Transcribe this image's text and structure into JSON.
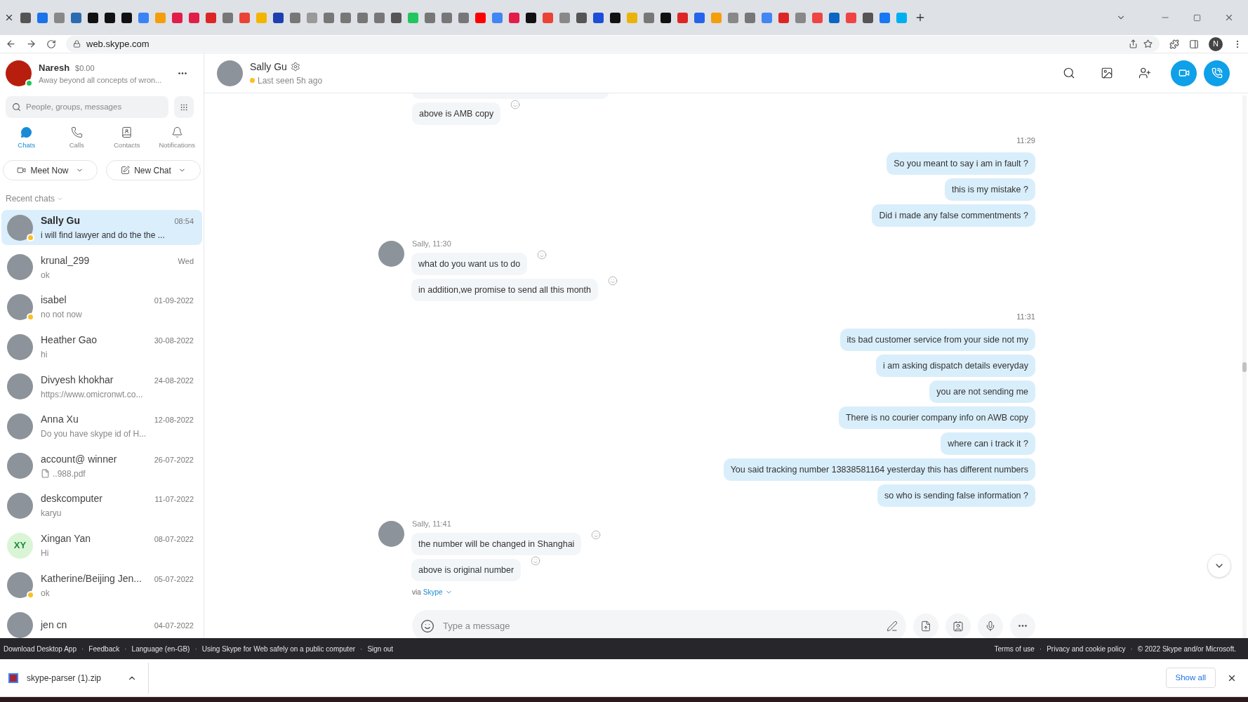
{
  "browser": {
    "url": "web.skype.com",
    "profile_initial": "N"
  },
  "profile": {
    "name": "Naresh",
    "balance": "$0.00",
    "mood": "Away beyond all concepts of wron...",
    "online": true
  },
  "search": {
    "placeholder": "People, groups, messages"
  },
  "nav_tabs": [
    {
      "label": "Chats",
      "selected": true
    },
    {
      "label": "Calls",
      "selected": false
    },
    {
      "label": "Contacts",
      "selected": false
    },
    {
      "label": "Notifications",
      "selected": false
    }
  ],
  "actions": [
    {
      "label": "Meet Now"
    },
    {
      "label": "New Chat"
    }
  ],
  "recent_label": "Recent chats",
  "chats": [
    {
      "name": "Sally Gu",
      "preview": "i will find lawyer and do the the ...",
      "time": "08:54",
      "selected": true,
      "away": true,
      "bold": true
    },
    {
      "name": "krunal_299",
      "preview": "ok",
      "time": "Wed",
      "selected": false,
      "away": false,
      "bold": false
    },
    {
      "name": "isabel",
      "preview": "no not now",
      "time": "01-09-2022",
      "selected": false,
      "away": true,
      "bold": false
    },
    {
      "name": "Heather Gao",
      "preview": "hi",
      "time": "30-08-2022",
      "selected": false,
      "away": false,
      "bold": false
    },
    {
      "name": "Divyesh khokhar",
      "preview": "https://www.omicronwt.co...",
      "time": "24-08-2022",
      "selected": false,
      "away": false,
      "bold": false
    },
    {
      "name": "Anna Xu",
      "preview": "Do you have skype id of H...",
      "time": "12-08-2022",
      "selected": false,
      "away": false,
      "bold": false
    },
    {
      "name": "account@ winner",
      "preview": "..988.pdf",
      "file": true,
      "time": "26-07-2022",
      "selected": false,
      "away": false,
      "bold": false
    },
    {
      "name": "deskcomputer",
      "preview": "karyu",
      "time": "11-07-2022",
      "selected": false,
      "away": false,
      "bold": false
    },
    {
      "name": "Xingan  Yan",
      "initials": "XY",
      "preview": "Hi",
      "time": "08-07-2022",
      "selected": false,
      "away": false,
      "bold": false
    },
    {
      "name": "Katherine/Beijing Jen...",
      "preview": "ok",
      "time": "05-07-2022",
      "selected": false,
      "away": true,
      "bold": false
    },
    {
      "name": "jen cn",
      "time": "04-07-2022",
      "selected": false,
      "away": false,
      "bold": false
    }
  ],
  "conversation": {
    "name": "Sally Gu",
    "status": "Last seen 5h ago",
    "away": true
  },
  "messages": [
    {
      "kind": "incoming",
      "texts": [
        "above is AMB copy"
      ],
      "cut_top": true
    },
    {
      "kind": "time",
      "text": "11:29"
    },
    {
      "kind": "outgoing",
      "texts": [
        "So you meant to say i am in fault ?",
        "this is my mistake ?",
        "Did i made any false commentments ?"
      ]
    },
    {
      "kind": "incoming",
      "sender": "Sally, 11:30",
      "texts": [
        "what do you want us to do",
        "in addition,we promise to send all this month"
      ]
    },
    {
      "kind": "time",
      "text": "11:31"
    },
    {
      "kind": "outgoing",
      "texts": [
        "its bad customer service from your side not my",
        "i am asking dispatch details everyday",
        "you are not sending me",
        "There is no courier company info on AWB copy",
        "where can i track it ?",
        "You said tracking number 13838581164 yesterday this has different numbers",
        "so who is sending false information ?"
      ]
    },
    {
      "kind": "incoming",
      "sender": "Sally, 11:41",
      "texts": [
        "the number will be changed in Shanghai",
        "above is original number"
      ]
    }
  ],
  "via": {
    "prefix": "via",
    "link": "Skype"
  },
  "composer": {
    "placeholder": "Type a message"
  },
  "footer": {
    "separator": "·",
    "left": [
      "Download Desktop App",
      "Feedback",
      "Language (en-GB)",
      "Using Skype for Web safely on a public computer",
      "Sign out"
    ],
    "right": [
      "Terms of use",
      "Privacy and cookie policy",
      "© 2022 Skype and/or Microsoft."
    ]
  },
  "download": {
    "file": "skype-parser (1).zip",
    "show_all": "Show all"
  }
}
